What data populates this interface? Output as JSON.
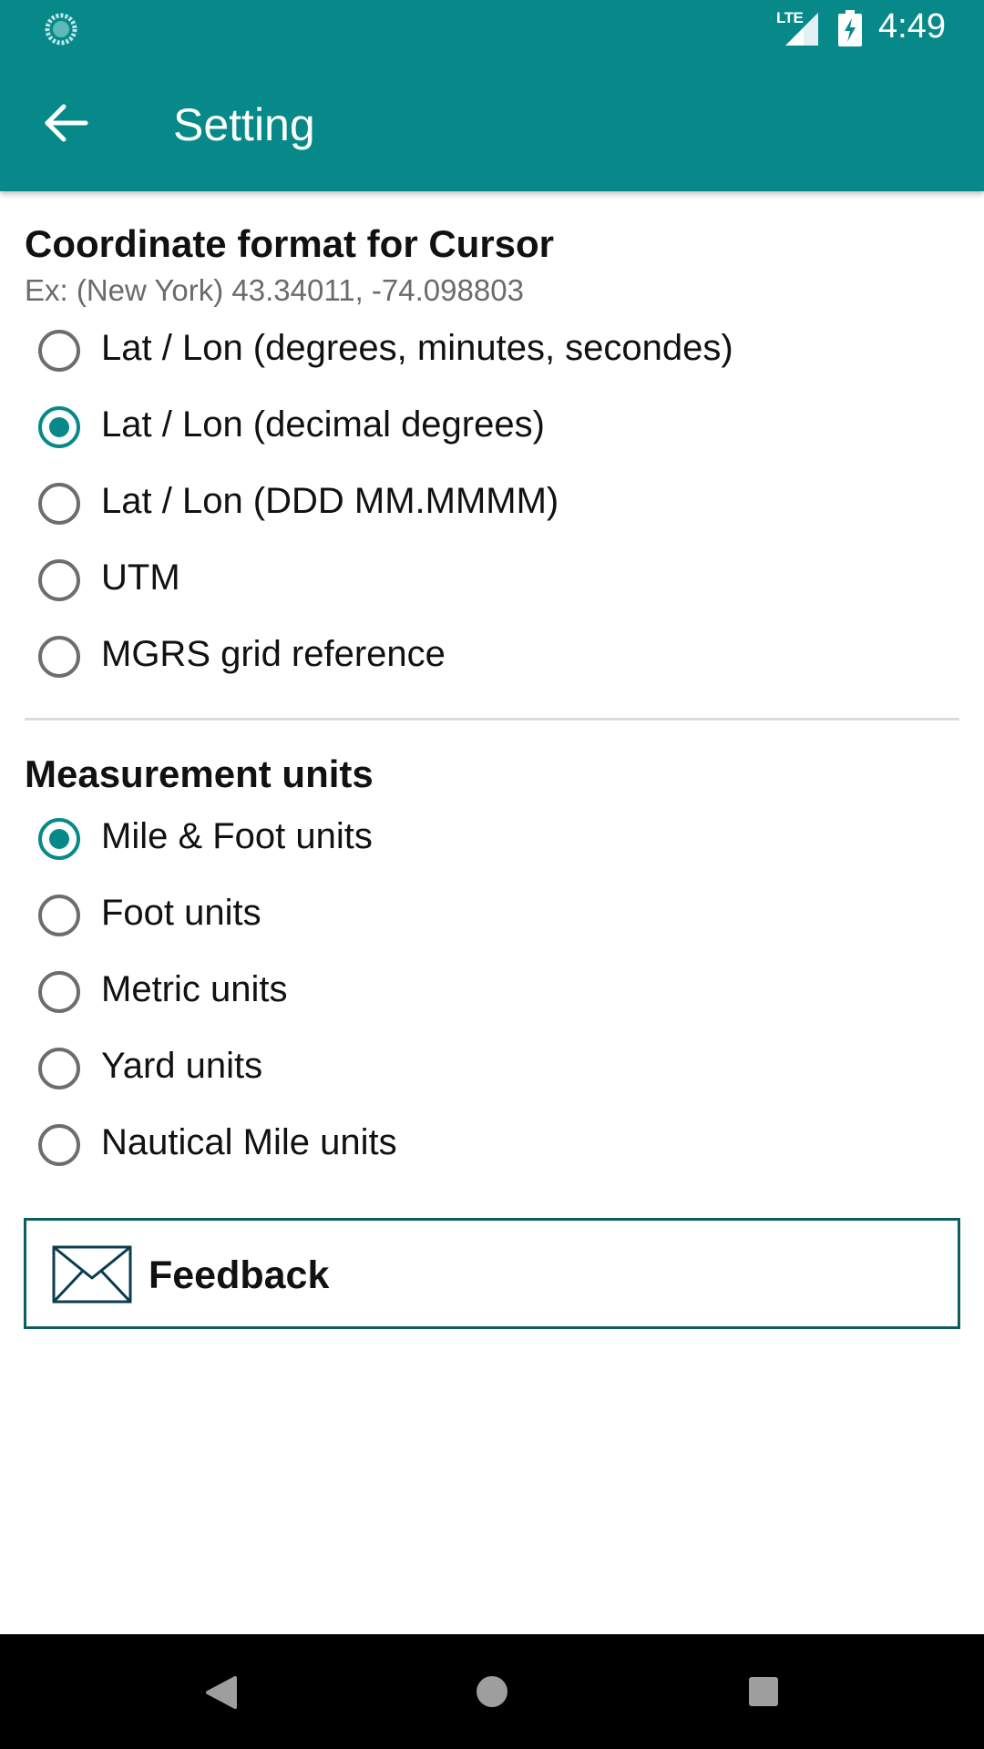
{
  "status_bar": {
    "network": "LTE",
    "time": "4:49",
    "icons": [
      "sync-spinner-icon",
      "lte-signal-icon",
      "battery-charging-icon"
    ]
  },
  "app_bar": {
    "title": "Setting",
    "back_icon": "arrow-back-icon"
  },
  "coordinate_section": {
    "title": "Coordinate format for Cursor",
    "example": "Ex: (New York) 43.34011,   -74.098803",
    "options": [
      {
        "label": "Lat / Lon (degrees, minutes, secondes)",
        "checked": false
      },
      {
        "label": "Lat / Lon (decimal degrees)",
        "checked": true
      },
      {
        "label": "Lat / Lon (DDD MM.MMMM)",
        "checked": false
      },
      {
        "label": "UTM",
        "checked": false
      },
      {
        "label": "MGRS grid reference",
        "checked": false
      }
    ]
  },
  "measurement_section": {
    "title": "Measurement units",
    "options": [
      {
        "label": "Mile & Foot units",
        "checked": true
      },
      {
        "label": "Foot units",
        "checked": false
      },
      {
        "label": "Metric units",
        "checked": false
      },
      {
        "label": "Yard units",
        "checked": false
      },
      {
        "label": "Nautical Mile units",
        "checked": false
      }
    ]
  },
  "feedback": {
    "label": "Feedback",
    "icon": "mail-icon"
  },
  "nav_bar": {
    "buttons": [
      "back-triangle-icon",
      "home-circle-icon",
      "recents-square-icon"
    ]
  },
  "colors": {
    "accent": "#07898a",
    "feedback_border": "#0b5e60",
    "secondary_text": "#6b6b6b"
  }
}
